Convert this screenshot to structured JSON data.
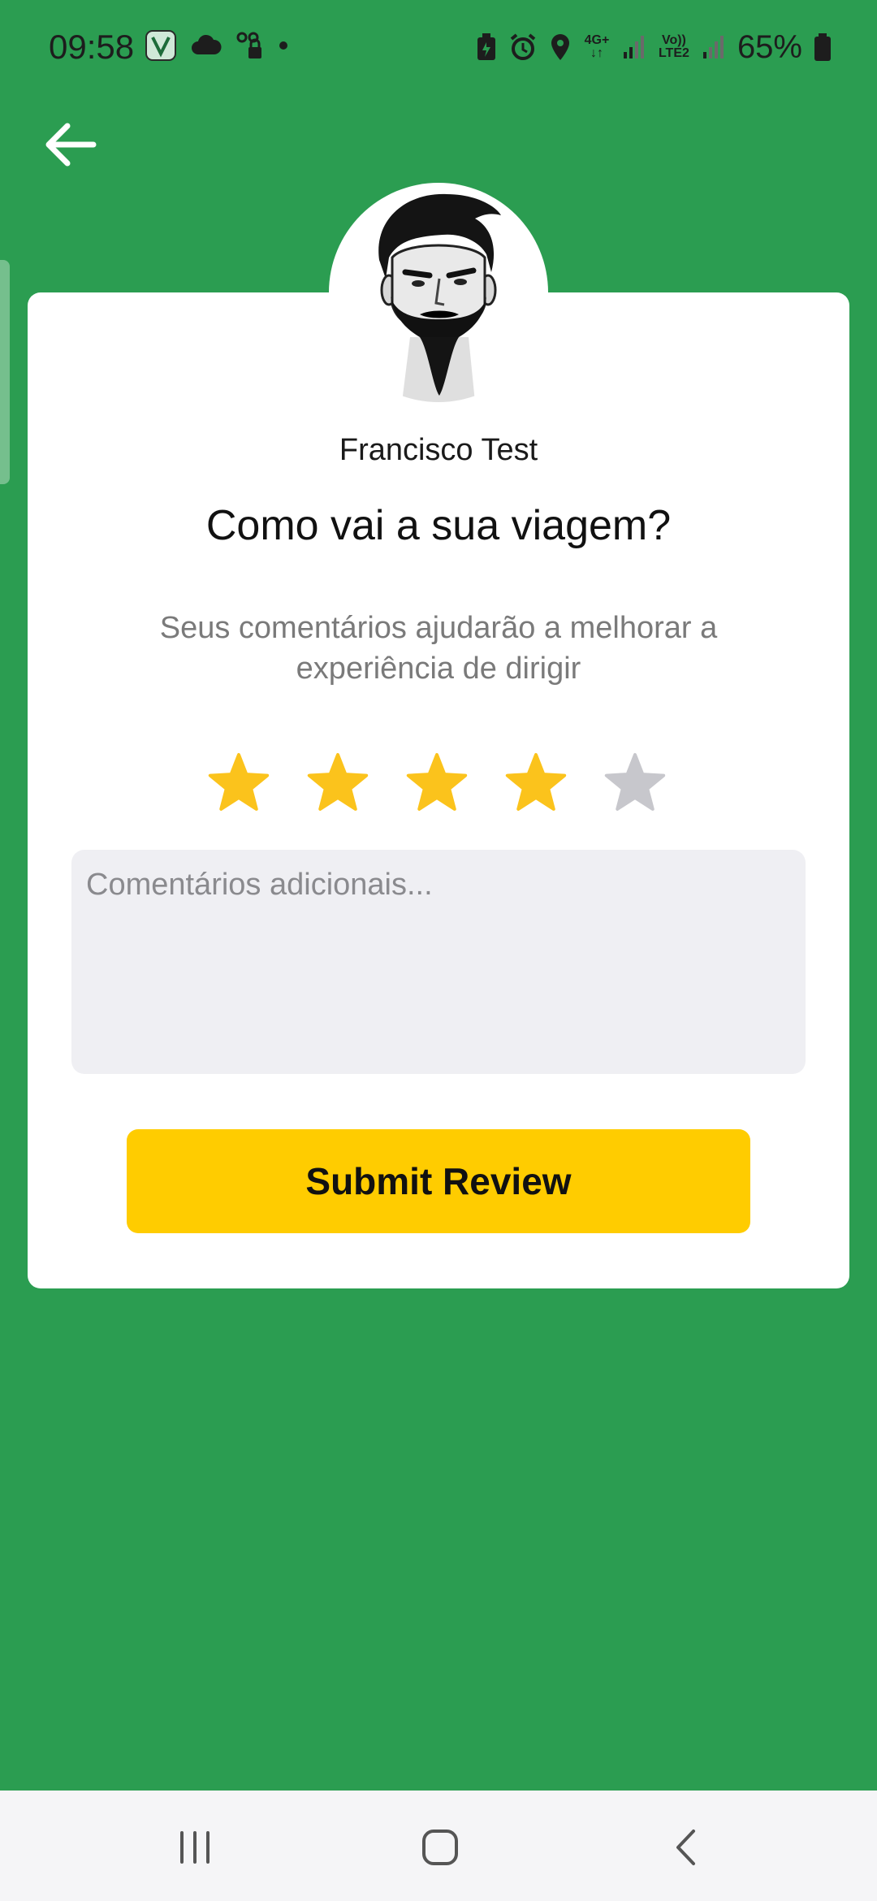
{
  "status_bar": {
    "time": "09:58",
    "battery": "65%",
    "network_top": "4G+",
    "network_lte": "Vo))",
    "network_lte2": "LTE2"
  },
  "driver": {
    "name": "Francisco Test"
  },
  "review": {
    "question": "Como vai a sua viagem?",
    "subtitle": "Seus comentários ajudarão a melhorar a experiência de dirigir",
    "rating": 4,
    "max_rating": 5,
    "comment_placeholder": "Comentários adicionais...",
    "comment_value": "",
    "submit_label": "Submit Review"
  },
  "colors": {
    "background": "#2b9d51",
    "card": "#ffffff",
    "star_filled": "#fbc31c",
    "star_empty": "#c7c7cc",
    "button": "#ffcc00"
  }
}
